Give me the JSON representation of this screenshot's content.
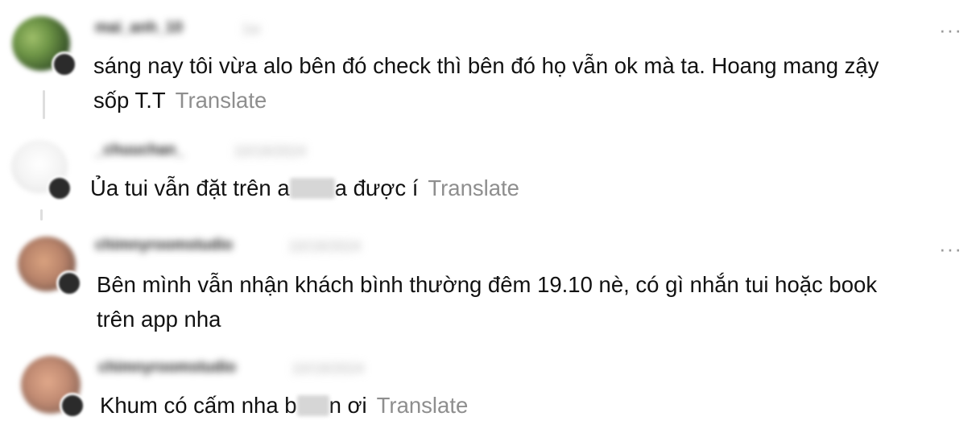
{
  "comments": [
    {
      "username": "mai_anh_10",
      "timestamp": "1w",
      "text_line1": "sáng nay tôi vừa alo bên đó check thì bên đó họ vẫn ok mà ta. Hoang mang zậy",
      "text_line2": "sốp T.T",
      "translate_label": "Translate",
      "more_icon": "···"
    },
    {
      "username": "_chuuchan_",
      "timestamp": "10/19/2024",
      "text_before": "Ủa tui vẫn đặt trên a",
      "text_after": "a được í",
      "translate_label": "Translate"
    },
    {
      "username": "chimnyroomstudio",
      "timestamp": "10/19/2024",
      "text_line1": "Bên mình vẫn nhận khách bình thường đêm 19.10 nè, có gì nhắn tui hoặc book",
      "text_line2": "trên app nha",
      "more_icon": "···"
    },
    {
      "username": "chimnyroomstudio",
      "timestamp": "10/19/2024",
      "text_before": "Khum có cấm nha b",
      "text_after": "n ơi",
      "translate_label": "Translate"
    }
  ]
}
